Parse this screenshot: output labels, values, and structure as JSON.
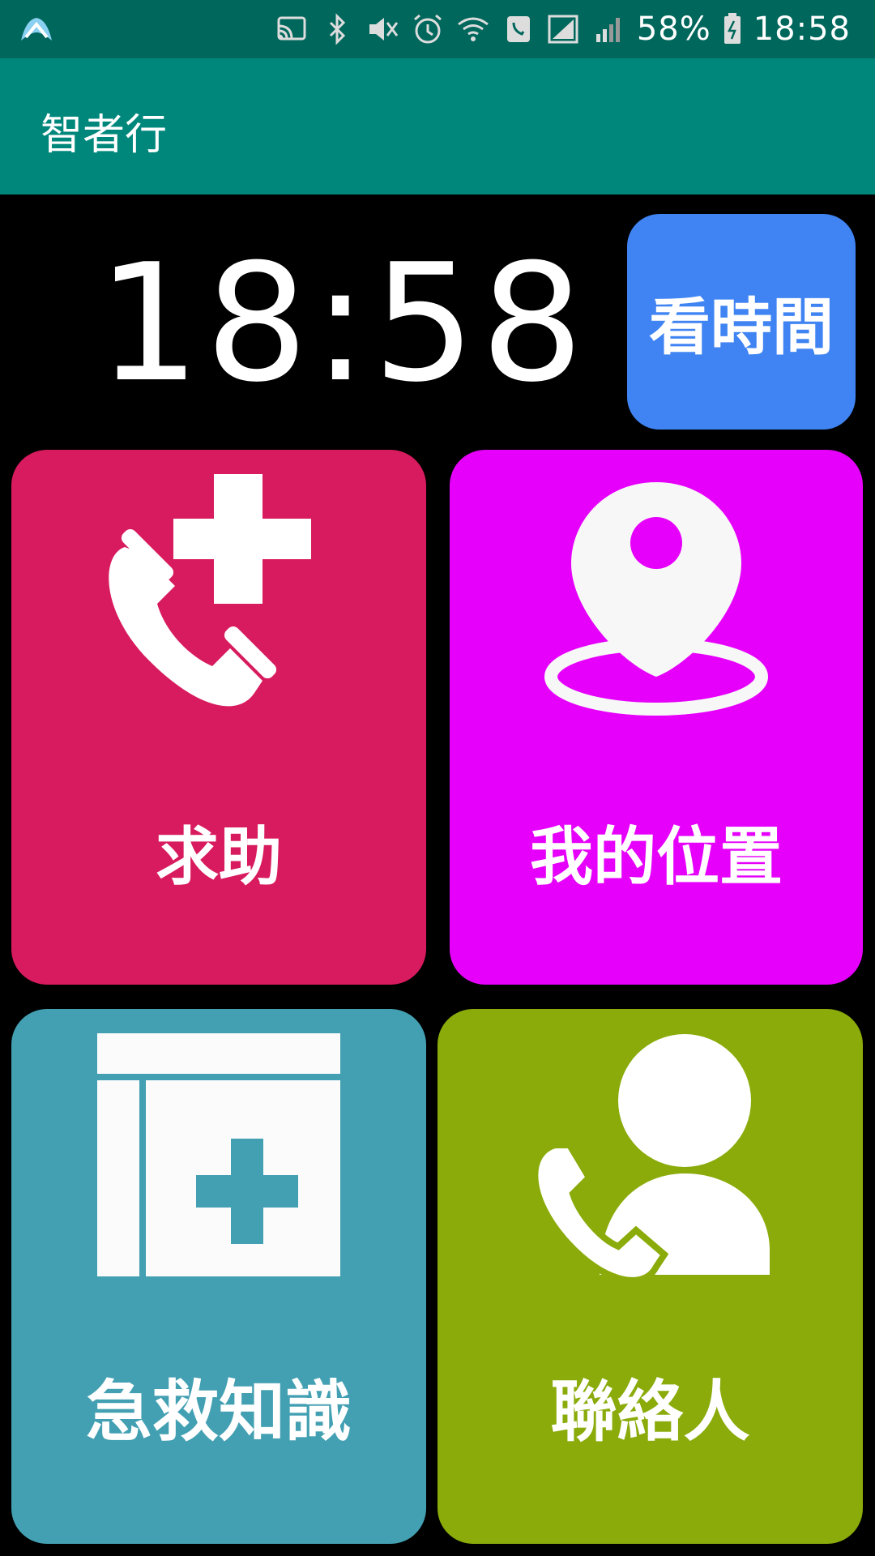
{
  "status_bar": {
    "battery_percent": "58%",
    "time": "18:58",
    "icons": [
      "app-logo-icon",
      "cast-icon",
      "bluetooth-icon",
      "mute-icon",
      "alarm-icon",
      "wifi-call-icon",
      "signal-icon",
      "battery-icon"
    ]
  },
  "app": {
    "title": "智者行"
  },
  "clock": {
    "time": "18:58"
  },
  "buttons": {
    "view_time": "看時間"
  },
  "tiles": [
    {
      "label": "求助",
      "icon": "emergency-call-icon",
      "color": "#d81b5e"
    },
    {
      "label": "我的位置",
      "icon": "location-pin-icon",
      "color": "#e600fb"
    },
    {
      "label": "急救知識",
      "icon": "first-aid-book-icon",
      "color": "#43a0b2"
    },
    {
      "label": "聯絡人",
      "icon": "contact-phone-icon",
      "color": "#8aab0a"
    }
  ]
}
